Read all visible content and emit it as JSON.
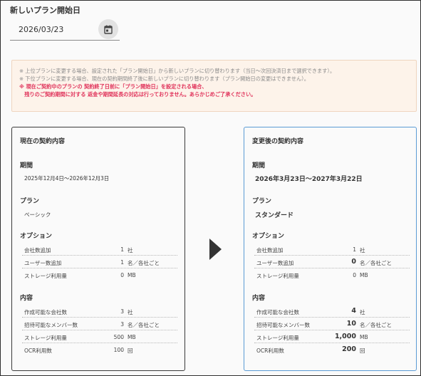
{
  "start_date": {
    "label": "新しいプラン開始日",
    "value": "2026/03/23",
    "icon": "calendar-icon"
  },
  "notice": {
    "lines": [
      "※ 上位プランに変更する場合、設定された「プラン開始日」から新しいプランに切り替わります（当日〜次回決済日まで選択できます）。",
      "※ 下位プランに変更する場合、現在の契約期間終了後に新しいプランに切り替わります（プラン開始日の変更はできません）。"
    ],
    "warning_lines": [
      "※ 現在ご契約中のプランの 契約終了日前に「プラン開始日」を設定される場合、",
      "　残りのご契約期間に対する 返金や期間延長の対応は行っておりません。あらかじめご了承ください。"
    ]
  },
  "current": {
    "title": "現在の契約内容",
    "period_label": "期間",
    "period": "2025年12月4日〜2026年12月3日",
    "plan_label": "プラン",
    "plan": "ベーシック",
    "options_label": "オプション",
    "options": [
      {
        "label": "会社数追加",
        "value": "1",
        "unit": "社"
      },
      {
        "label": "ユーザー数追加",
        "value": "1",
        "unit": "名／各社ごと"
      },
      {
        "label": "ストレージ利用量",
        "value": "0",
        "unit": "MB"
      }
    ],
    "contents_label": "内容",
    "contents": [
      {
        "label": "作成可能な会社数",
        "value": "3",
        "unit": "社"
      },
      {
        "label": "招待可能なメンバー数",
        "value": "3",
        "unit": "名／各社ごと"
      },
      {
        "label": "ストレージ利用量",
        "value": "500",
        "unit": "MB"
      },
      {
        "label": "OCR利用数",
        "value": "100",
        "unit": "回"
      }
    ]
  },
  "after": {
    "title": "変更後の契約内容",
    "period_label": "期間",
    "period": "2026年3月23日〜2027年3月22日",
    "plan_label": "プラン",
    "plan": "スタンダード",
    "options_label": "オプション",
    "options": [
      {
        "label": "会社数追加",
        "value": "1",
        "unit": "社"
      },
      {
        "label": "ユーザー数追加",
        "value": "0",
        "unit": "名／各社ごと"
      },
      {
        "label": "ストレージ利用量",
        "value": "0",
        "unit": "MB"
      }
    ],
    "contents_label": "内容",
    "contents": [
      {
        "label": "作成可能な会社数",
        "value": "4",
        "unit": "社"
      },
      {
        "label": "招待可能なメンバー数",
        "value": "10",
        "unit": "名／各社ごと"
      },
      {
        "label": "ストレージ利用量",
        "value": "1,000",
        "unit": "MB"
      },
      {
        "label": "OCR利用数",
        "value": "200",
        "unit": "回"
      }
    ]
  },
  "colors": {
    "warning": "#e0325a",
    "notice_bg": "#fdf3ea",
    "after_border": "#5b9bd5"
  }
}
